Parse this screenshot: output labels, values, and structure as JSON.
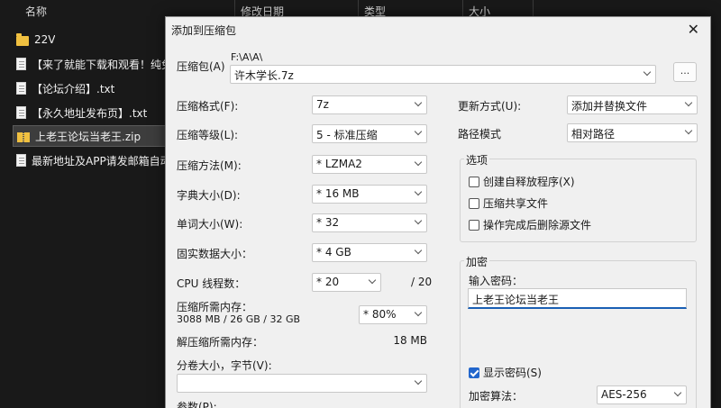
{
  "explorer": {
    "columns": [
      "名称",
      "修改日期",
      "类型",
      "大小"
    ],
    "files": [
      {
        "name": "22V",
        "kind": "folder",
        "selected": false
      },
      {
        "name": "【来了就能下载和观看！纯免",
        "kind": "txt",
        "selected": false
      },
      {
        "name": "【论坛介绍】.txt",
        "kind": "txt",
        "selected": false
      },
      {
        "name": "【永久地址发布页】.txt",
        "kind": "txt",
        "selected": false
      },
      {
        "name": "上老王论坛当老王.zip",
        "kind": "zip",
        "selected": true
      },
      {
        "name": "最新地址及APP请发邮箱自动",
        "kind": "txt",
        "selected": false
      }
    ]
  },
  "dialog": {
    "title": "添加到压缩包",
    "close_glyph": "✕",
    "archive_label": "压缩包(A)",
    "archive_path": "F:\\A\\A\\",
    "archive_name": "许木学长.7z",
    "browse_label": "...",
    "format_label": "压缩格式(F):",
    "format_value": "7z",
    "level_label": "压缩等级(L):",
    "level_value": "5 - 标准压缩",
    "method_label": "压缩方法(M):",
    "method_value": "* LZMA2",
    "dict_label": "字典大小(D):",
    "dict_value": "* 16 MB",
    "word_label": "单词大小(W):",
    "word_value": "* 32",
    "solid_label": "固实数据大小：",
    "solid_value": "* 4 GB",
    "threads_label": "CPU 线程数：",
    "threads_value": "* 20",
    "threads_total": "/ 20",
    "mem_comp_label": "压缩所需内存：",
    "mem_comp_value": "3088 MB / 26 GB / 32 GB",
    "mem_comp_percent": "* 80%",
    "mem_decomp_label": "解压缩所需内存：",
    "mem_decomp_value": "18 MB",
    "volume_label": "分卷大小，字节(V):",
    "volume_value": "",
    "params_label": "参数(P):",
    "update_label": "更新方式(U):",
    "update_value": "添加并替换文件",
    "path_label": "路径模式",
    "path_value": "相对路径",
    "options_title": "选项",
    "opt_sfx": "创建自释放程序(X)",
    "opt_shared": "压缩共享文件",
    "opt_delete": "操作完成后删除源文件",
    "encrypt_title": "加密",
    "password_label": "输入密码：",
    "password_value": "上老王论坛当老王",
    "show_password": "显示密码(S)",
    "enc_method_label": "加密算法：",
    "enc_method_value": "AES-256"
  }
}
